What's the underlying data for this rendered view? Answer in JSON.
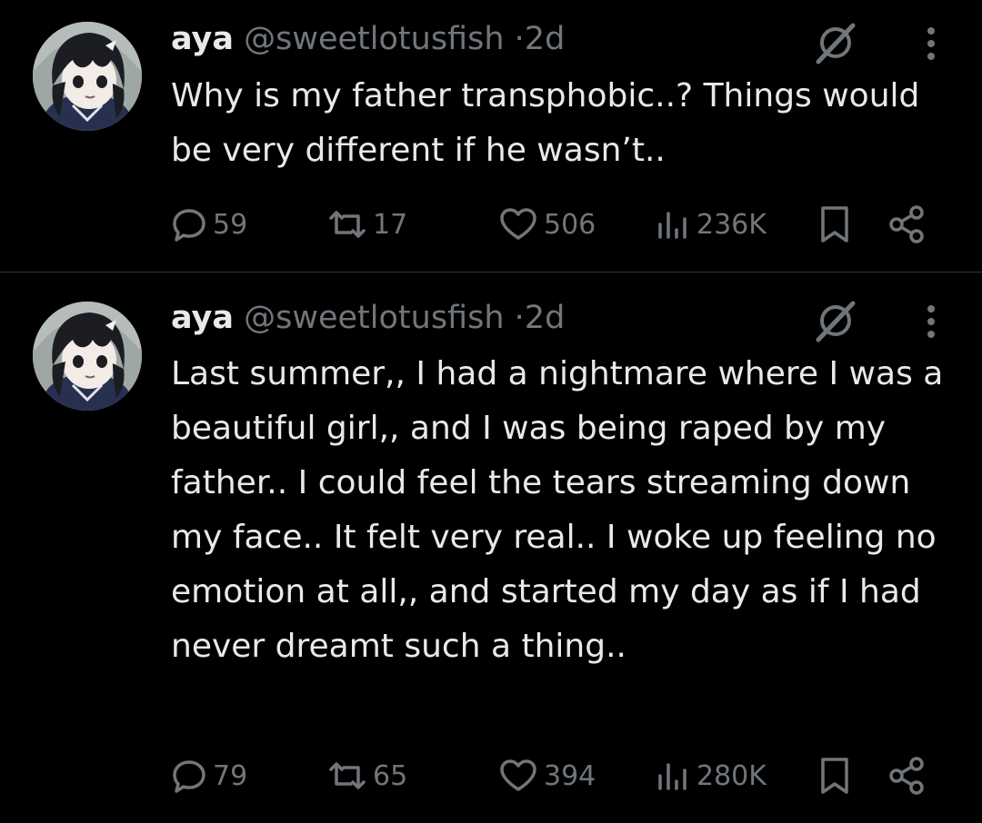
{
  "colors": {
    "background": "#000000",
    "primary_text": "#e7e9ea",
    "secondary_text": "#71767b",
    "divider": "#2f3336"
  },
  "tweets": [
    {
      "display_name": "aya",
      "handle": "@sweetlotusfish",
      "separator": "·",
      "time": "2d",
      "text": "Why is my father transphobic..? Things would be very different if he wasn’t..",
      "replies": "59",
      "reposts": "17",
      "likes": "506",
      "views": "236K",
      "icons": [
        "avatar",
        "grok-icon",
        "more-icon",
        "reply-icon",
        "repost-icon",
        "like-icon",
        "views-icon",
        "bookmark-icon",
        "share-icon"
      ]
    },
    {
      "display_name": "aya",
      "handle": "@sweetlotusfish",
      "separator": "·",
      "time": "2d",
      "text": "Last summer,, I had a nightmare where I was a beautiful girl,, and I was being raped by my father.. I could feel the tears streaming down my face.. It felt very real.. I woke up feeling no emotion at all,, and started my day as if I had never dreamt such a thing..",
      "replies": "79",
      "reposts": "65",
      "likes": "394",
      "views": "280K",
      "icons": [
        "avatar",
        "grok-icon",
        "more-icon",
        "reply-icon",
        "repost-icon",
        "like-icon",
        "views-icon",
        "bookmark-icon",
        "share-icon"
      ]
    }
  ]
}
